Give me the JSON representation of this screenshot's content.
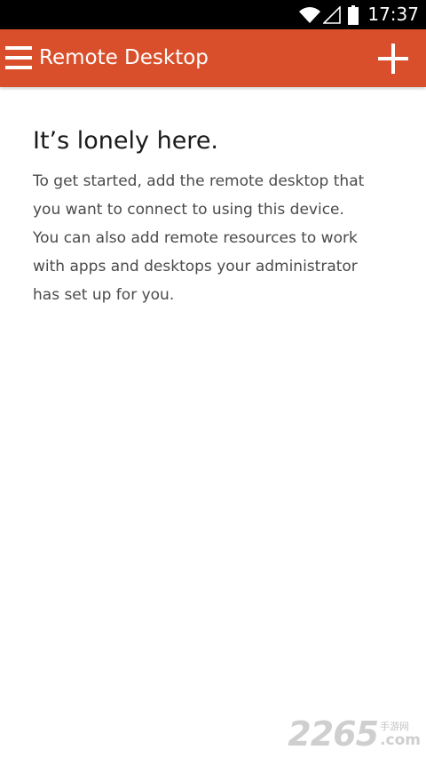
{
  "status_bar": {
    "time": "17:37",
    "icons": [
      "wifi-icon",
      "signal-icon",
      "battery-icon"
    ]
  },
  "app_bar": {
    "title": "Remote Desktop",
    "menu_icon": "menu-icon",
    "add_icon": "add-icon",
    "color": "#d94f2b"
  },
  "empty_state": {
    "title": "It’s lonely here.",
    "lines": [
      "To get started, add the remote desktop that",
      "you want to connect to using this device.",
      "You can also add remote resources to work",
      "with apps and desktops your administrator",
      "has set up for you."
    ]
  },
  "watermark": {
    "digits": "2265",
    "cn": "手游网",
    "com": ".com"
  }
}
